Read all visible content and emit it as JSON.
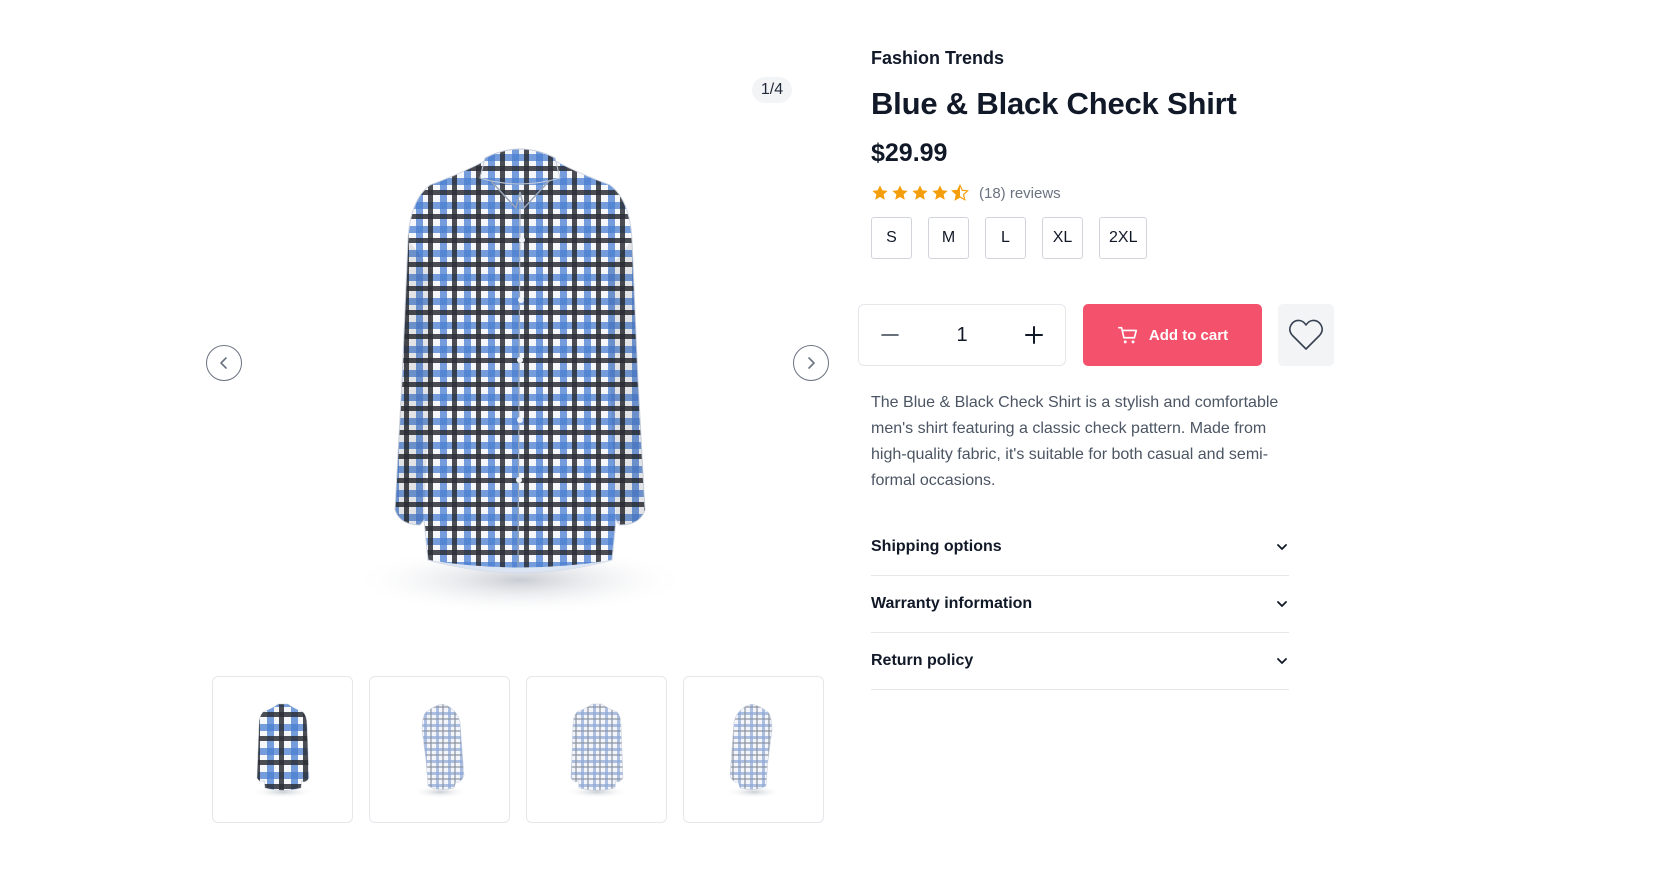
{
  "gallery": {
    "counter": "1/4",
    "thumbnails": [
      "Front view",
      "Left side view",
      "Back view",
      "Right side view"
    ]
  },
  "product": {
    "brand": "Fashion Trends",
    "title": "Blue & Black Check Shirt",
    "price": "$29.99",
    "rating": 4.5,
    "reviews_label": "(18) reviews",
    "sizes": [
      "S",
      "M",
      "L",
      "XL",
      "2XL"
    ],
    "quantity": "1",
    "add_to_cart_label": "Add to cart",
    "description": "The Blue & Black Check Shirt is a stylish and comfortable men's shirt featuring a classic check pattern. Made from high-quality fabric, it's suitable for both casual and semi-formal occasions."
  },
  "accordion": [
    {
      "label": "Shipping options"
    },
    {
      "label": "Warranty information"
    },
    {
      "label": "Return policy"
    }
  ],
  "colors": {
    "accent": "#f4516c",
    "star": "#f59e0b",
    "text": "#111827",
    "muted": "#6b7280",
    "shirt_blue": "#4a7fd1",
    "shirt_dark": "#2b2f36"
  }
}
